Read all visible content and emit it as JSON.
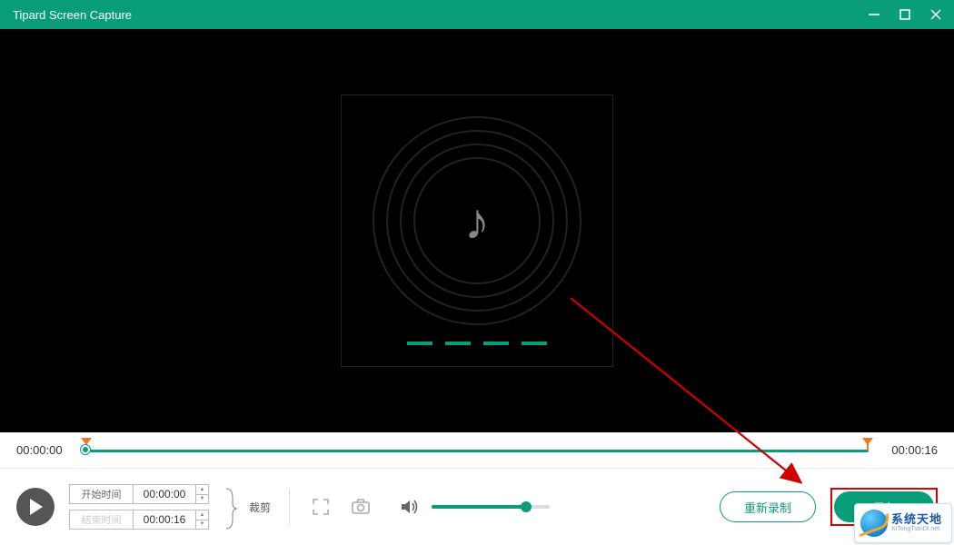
{
  "titlebar": {
    "title": "Tipard Screen Capture"
  },
  "timeline": {
    "start_time": "00:00:00",
    "end_time": "00:00:16"
  },
  "time_inputs": {
    "start_label": "开始时间",
    "start_value": "00:00:00",
    "end_label": "结束时间",
    "end_value": "00:00:16",
    "crop_label": "裁剪"
  },
  "buttons": {
    "rerecord": "重新录制",
    "save": "保存"
  },
  "watermark": {
    "cn": "系统天地",
    "en": "XiTongTianDi.net"
  },
  "colors": {
    "accent": "#0a9d7a",
    "annotation": "#d00000"
  }
}
